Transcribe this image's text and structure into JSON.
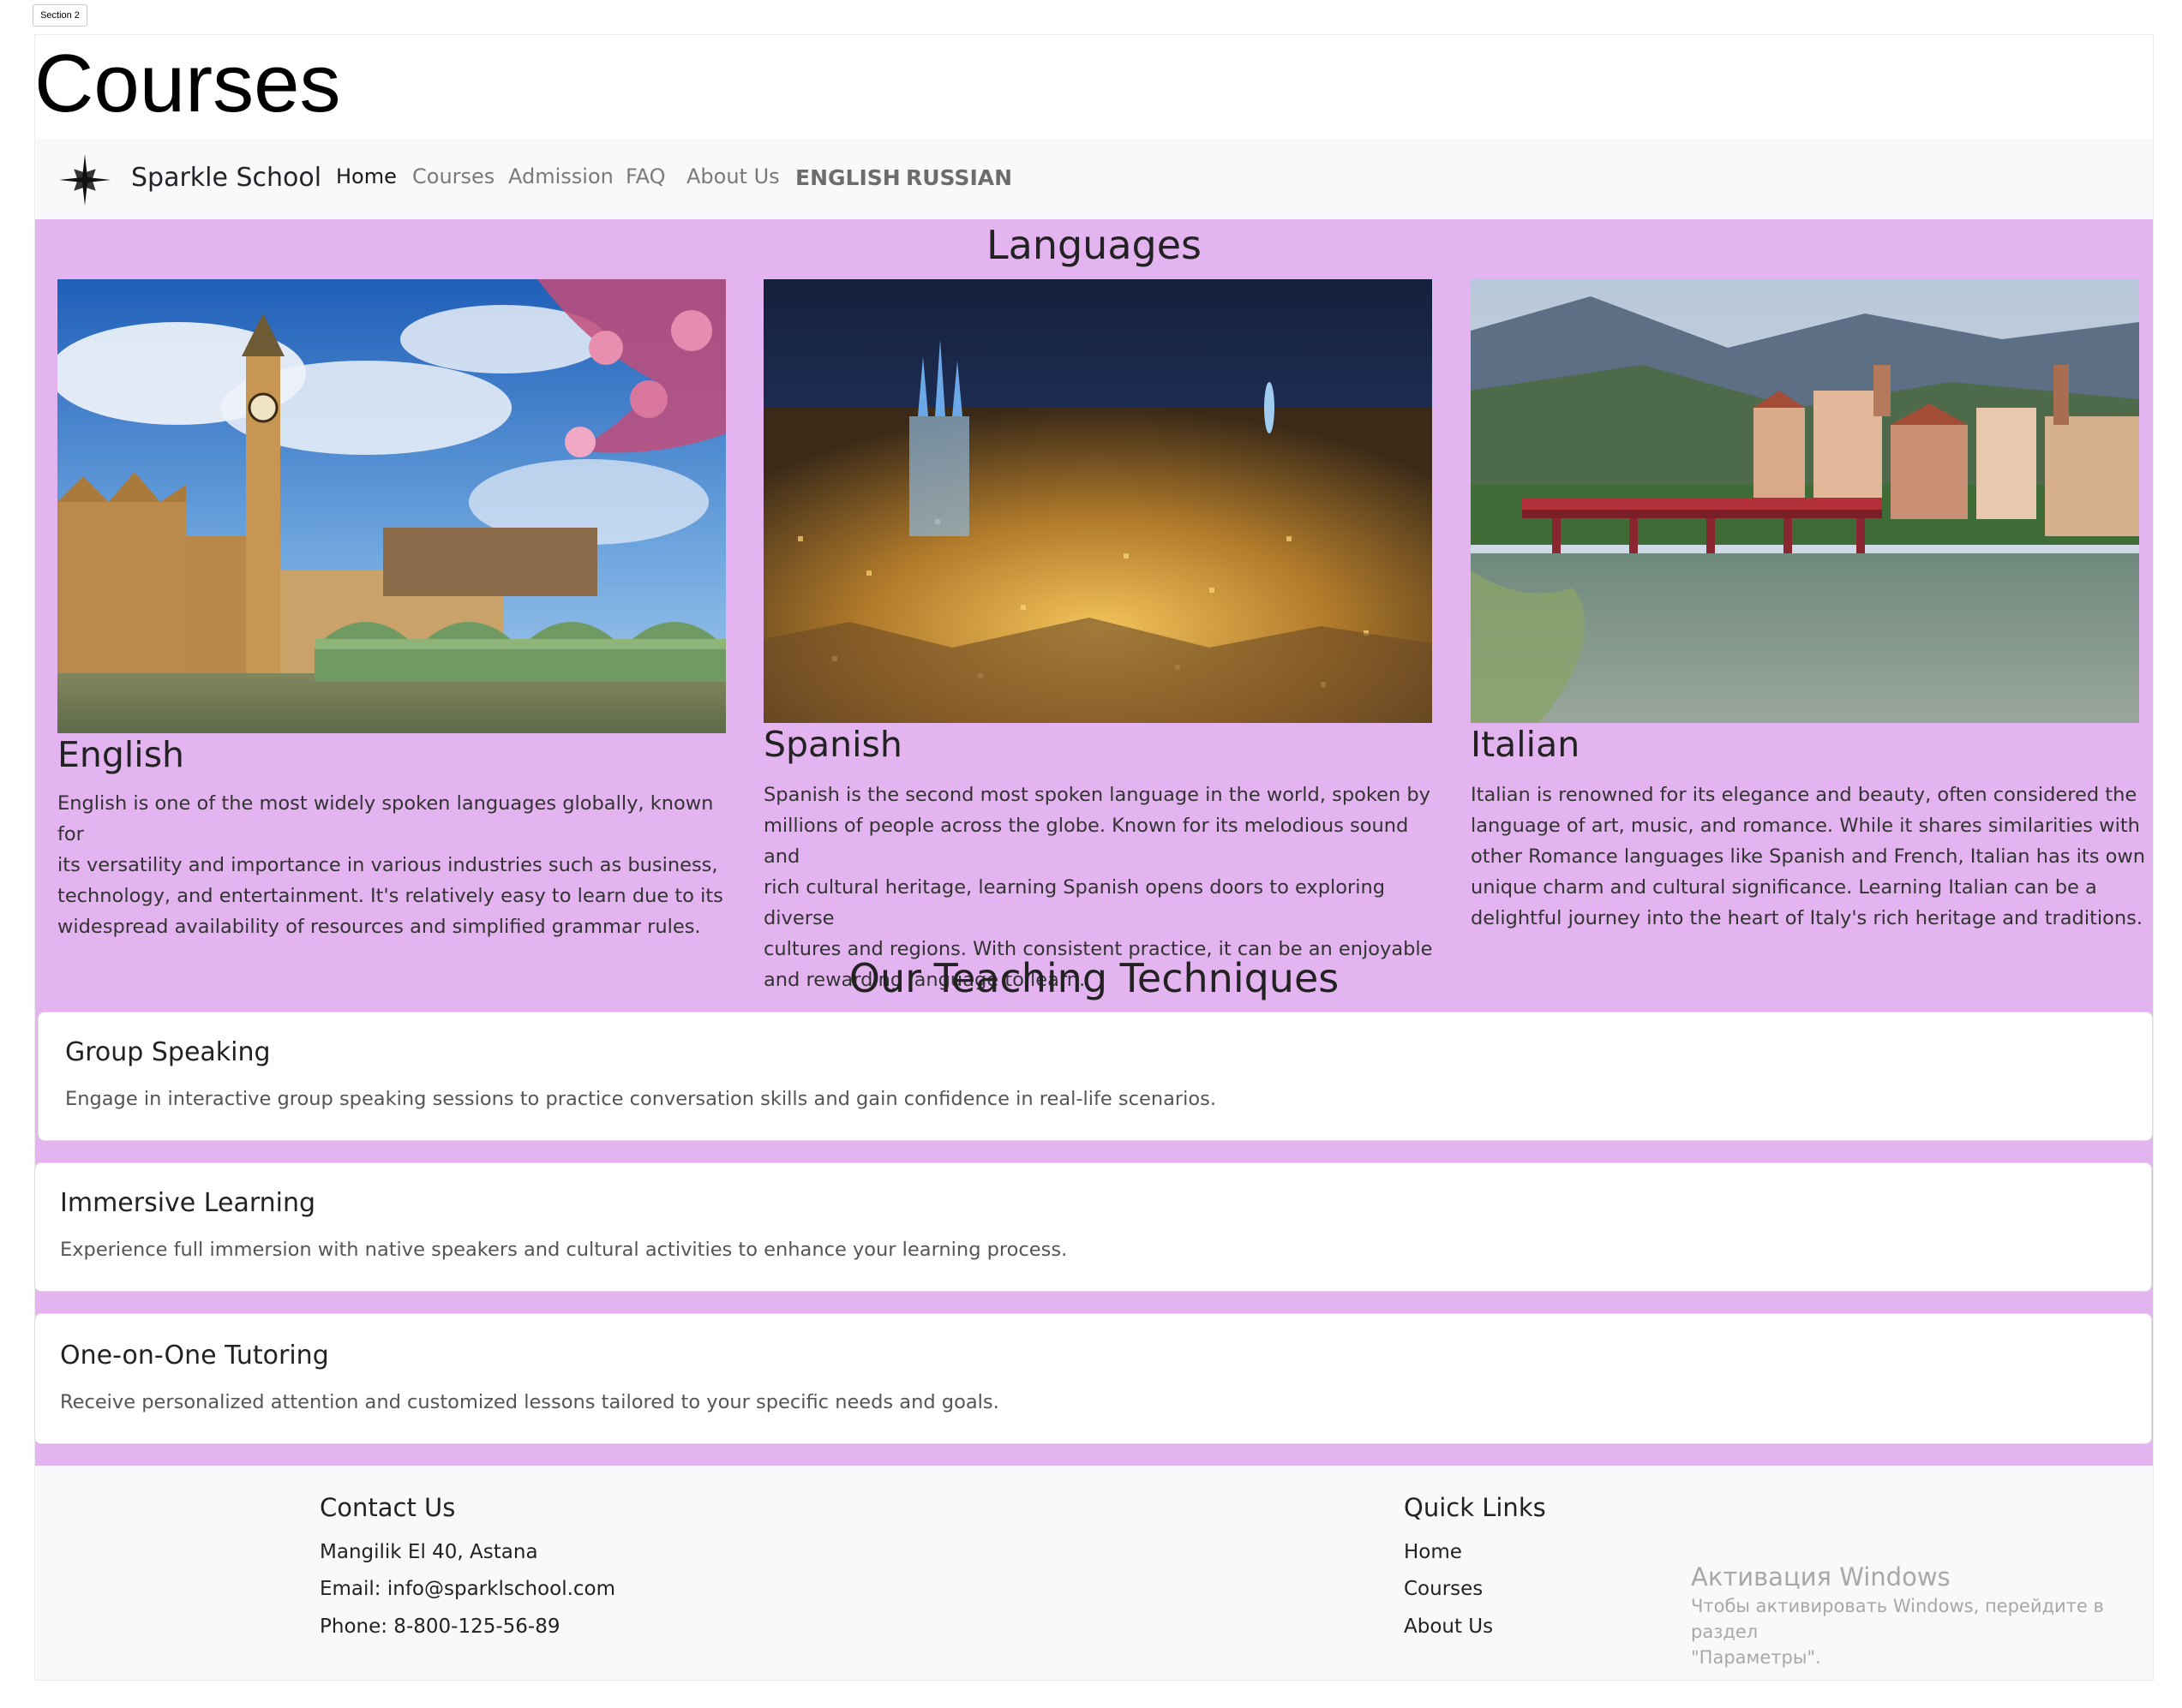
{
  "section_tag": "Section 2",
  "page_title": "Courses",
  "navbar": {
    "brand": "Sparkle School",
    "links": [
      "Home",
      "Courses",
      "Admission",
      "FAQ",
      "About Us"
    ],
    "active": "Home",
    "languages": [
      "ENGLISH",
      "RUSSIAN"
    ]
  },
  "languages_section": {
    "heading": "Languages",
    "cards": [
      {
        "name": "English",
        "image": "london-westminster-big-ben-photo",
        "lines": [
          "English is one of the most widely spoken languages globally, known for",
          "its versatility and importance in various industries such as business,",
          "technology, and entertainment. It's relatively easy to learn due to its",
          "widespread availability of resources and simplified grammar rules."
        ]
      },
      {
        "name": "Spanish",
        "image": "barcelona-night-city-photo",
        "lines": [
          "Spanish is the second most spoken language in the world, spoken by",
          "millions of people across the globe. Known for its melodious sound and",
          "rich cultural heritage, learning Spanish opens doors to exploring diverse",
          "cultures and regions. With consistent practice, it can be an enjoyable",
          "and rewarding language to learn."
        ]
      },
      {
        "name": "Italian",
        "image": "bassano-bridge-river-town-photo",
        "lines": [
          "Italian is renowned for its elegance and beauty, often considered the",
          "language of art, music, and romance. While it shares similarities with",
          "other Romance languages like Spanish and French, Italian has its own",
          "unique charm and cultural significance. Learning Italian can be a",
          "delightful journey into the heart of Italy's rich heritage and traditions."
        ]
      }
    ]
  },
  "techniques_section": {
    "heading": "Our Teaching Techniques",
    "items": [
      {
        "title": "Group Speaking",
        "text": "Engage in interactive group speaking sessions to practice conversation skills and gain confidence in real-life scenarios."
      },
      {
        "title": "Immersive Learning",
        "text": "Experience full immersion with native speakers and cultural activities to enhance your learning process."
      },
      {
        "title": "One-on-One Tutoring",
        "text": "Receive personalized attention and customized lessons tailored to your specific needs and goals."
      }
    ]
  },
  "footer": {
    "contact": {
      "heading": "Contact Us",
      "address": "Mangilik El 40, Astana",
      "email": "Email: info@sparklschool.com",
      "phone": "Phone: 8-800-125-56-89"
    },
    "quick_links": {
      "heading": "Quick Links",
      "links": [
        "Home",
        "Courses",
        "About Us"
      ]
    }
  },
  "windows_watermark": {
    "title": "Активация Windows",
    "line1": "Чтобы активировать Windows, перейдите в раздел",
    "line2": "\"Параметры\"."
  },
  "colors": {
    "purple_band": "#e3b4f0",
    "navbar_bg": "#f8f9fa",
    "footer_bg": "#f8f9fa"
  }
}
